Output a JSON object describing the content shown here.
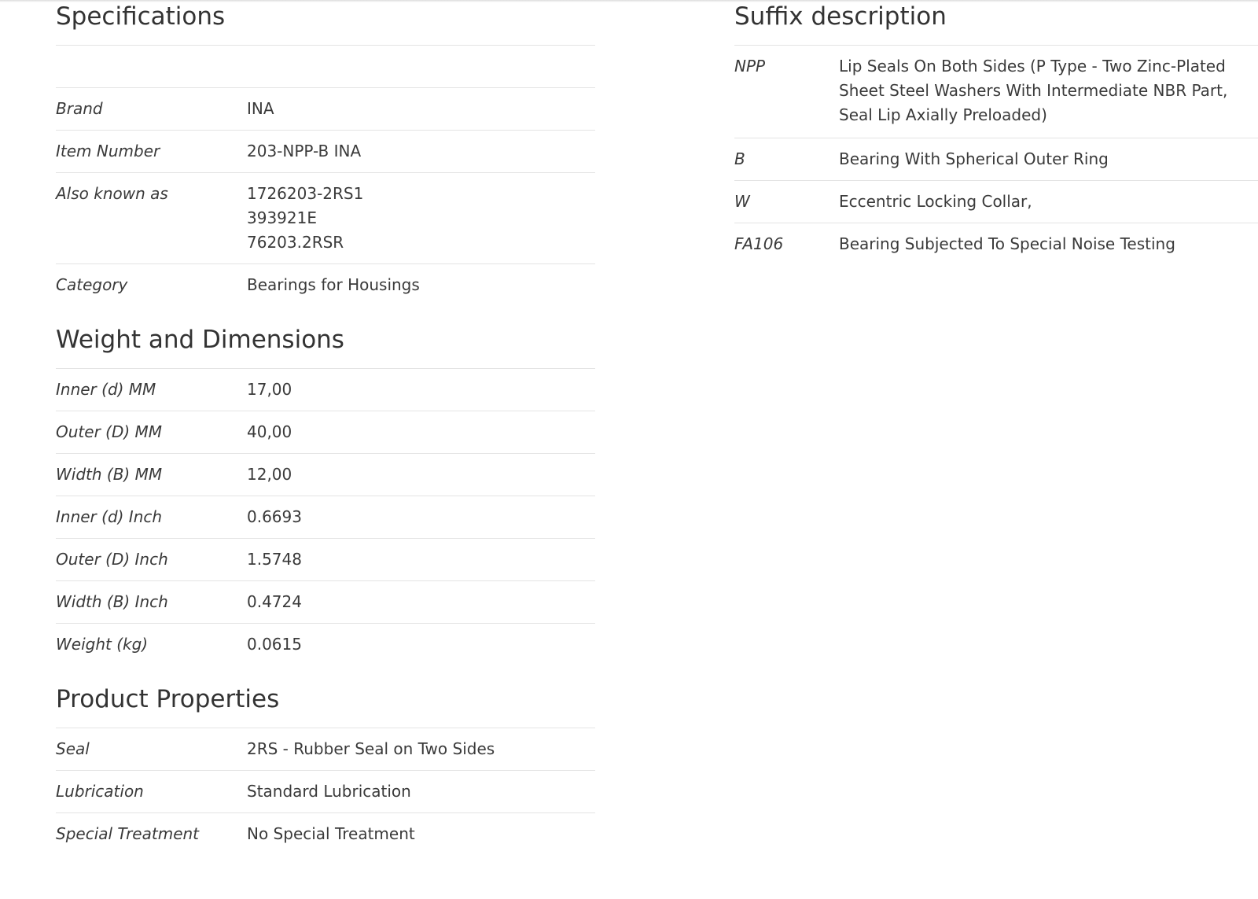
{
  "specifications": {
    "title": "Specifications",
    "rows": [
      {
        "label": "Brand",
        "value": "INA"
      },
      {
        "label": "Item Number",
        "value": "203-NPP-B INA"
      },
      {
        "label": "Also known as",
        "values": [
          "1726203-2RS1",
          "393921E",
          "76203.2RSR"
        ]
      },
      {
        "label": "Category",
        "value": "Bearings for Housings"
      }
    ]
  },
  "weight_dimensions": {
    "title": "Weight and Dimensions",
    "rows": [
      {
        "label": "Inner (d) MM",
        "value": "17,00"
      },
      {
        "label": "Outer (D) MM",
        "value": "40,00"
      },
      {
        "label": "Width (B) MM",
        "value": "12,00"
      },
      {
        "label": "Inner (d) Inch",
        "value": "0.6693"
      },
      {
        "label": "Outer (D) Inch",
        "value": "1.5748"
      },
      {
        "label": "Width (B) Inch",
        "value": "0.4724"
      },
      {
        "label": "Weight (kg)",
        "value": "0.0615"
      }
    ]
  },
  "product_properties": {
    "title": "Product Properties",
    "rows": [
      {
        "label": "Seal",
        "value": "2RS - Rubber Seal on Two Sides"
      },
      {
        "label": "Lubrication",
        "value": "Standard Lubrication"
      },
      {
        "label": "Special Treatment",
        "value": "No Special Treatment"
      }
    ]
  },
  "suffix_description": {
    "title": "Suffix description",
    "rows": [
      {
        "code": "NPP",
        "lines": [
          "Lip Seals On Both Sides (P Type - Two Zinc-Plated",
          "Sheet Steel Washers With Intermediate NBR Part,",
          "Seal Lip Axially Preloaded)"
        ]
      },
      {
        "code": "B",
        "lines": [
          "Bearing With Spherical Outer Ring"
        ]
      },
      {
        "code": "W",
        "lines": [
          "Eccentric Locking Collar,"
        ]
      },
      {
        "code": "FA106",
        "lines": [
          "Bearing Subjected To Special Noise Testing"
        ]
      }
    ]
  }
}
